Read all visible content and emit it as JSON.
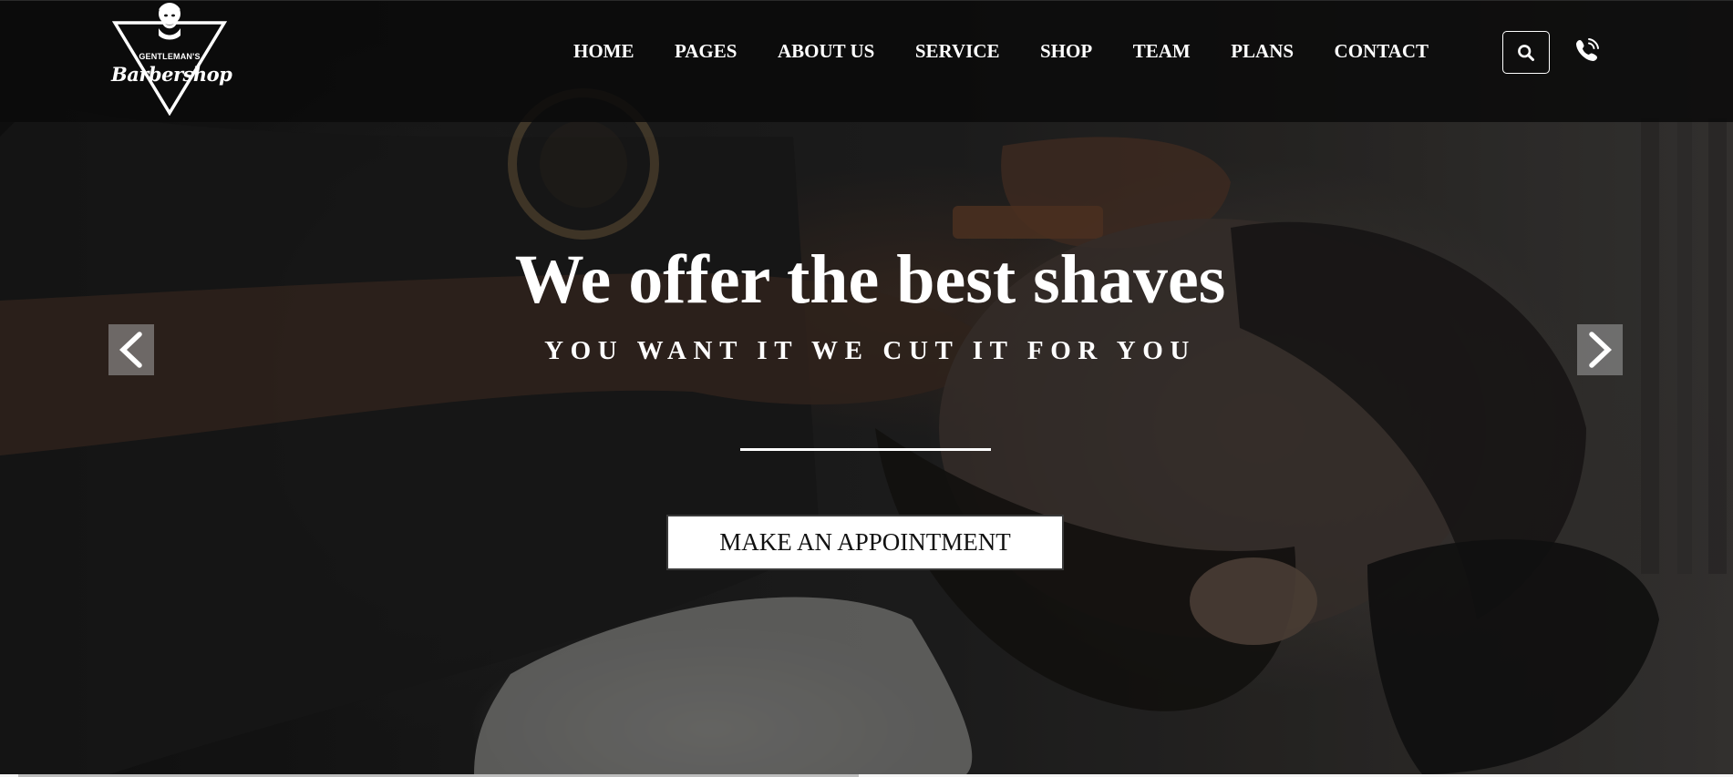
{
  "logo": {
    "tagline": "GENTLEMAN'S",
    "name": "Barbershop"
  },
  "nav": {
    "items": [
      {
        "label": "HOME"
      },
      {
        "label": "PAGES"
      },
      {
        "label": "ABOUT US"
      },
      {
        "label": "SERVICE"
      },
      {
        "label": "SHOP"
      },
      {
        "label": "TEAM"
      },
      {
        "label": "PLANS"
      },
      {
        "label": "CONTACT"
      }
    ],
    "search_icon": "search-icon",
    "phone_icon": "phone-icon"
  },
  "hero": {
    "title": "We offer the best shaves",
    "subtitle": "YOU WANT IT WE CUT IT FOR YOU",
    "cta_label": "MAKE AN APPOINTMENT",
    "prev_icon": "chevron-left-icon",
    "next_icon": "chevron-right-icon"
  },
  "slider": {
    "progress": 0.49
  },
  "colors": {
    "header_bg": "#0a0a0a",
    "text": "#ffffff",
    "cta_bg": "#ffffff",
    "cta_text": "#111111",
    "arrow_bg": "#969696"
  }
}
